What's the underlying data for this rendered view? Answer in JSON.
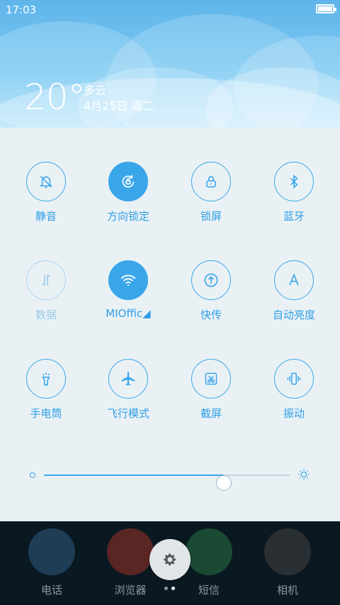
{
  "status_bar": {
    "time": "17:03"
  },
  "weather": {
    "temperature": "20°",
    "condition": "多云",
    "date": "4月25日 周二"
  },
  "toggles": [
    {
      "label": "静音",
      "icon": "bell-muted-icon",
      "state": "off"
    },
    {
      "label": "方向锁定",
      "icon": "rotation-lock-icon",
      "state": "on"
    },
    {
      "label": "锁屏",
      "icon": "lock-icon",
      "state": "off"
    },
    {
      "label": "蓝牙",
      "icon": "bluetooth-icon",
      "state": "off"
    },
    {
      "label": "数据",
      "icon": "data-arrows-icon",
      "state": "disabled"
    },
    {
      "label": "MIOffic◢",
      "icon": "wifi-icon",
      "state": "on"
    },
    {
      "label": "快传",
      "icon": "share-upload-icon",
      "state": "off"
    },
    {
      "label": "自动亮度",
      "icon": "auto-brightness-icon",
      "state": "off"
    },
    {
      "label": "手电筒",
      "icon": "flashlight-icon",
      "state": "off"
    },
    {
      "label": "飞行模式",
      "icon": "airplane-icon",
      "state": "off"
    },
    {
      "label": "截屏",
      "icon": "screenshot-icon",
      "state": "off"
    },
    {
      "label": "振动",
      "icon": "vibrate-icon",
      "state": "off"
    }
  ],
  "brightness": {
    "level": 0.73
  },
  "dock": {
    "apps": [
      {
        "label": "电话",
        "icon": "phone-icon",
        "color": "#3b7fb0"
      },
      {
        "label": "浏览器",
        "icon": "browser-icon",
        "color": "#e3463b"
      },
      {
        "label": "短信",
        "icon": "message-icon",
        "color": "#2bb463"
      },
      {
        "label": "相机",
        "icon": "camera-icon",
        "color": "#555555"
      }
    ]
  },
  "colors": {
    "accent": "#3aa6ea",
    "panel": "#eaf1f5"
  }
}
